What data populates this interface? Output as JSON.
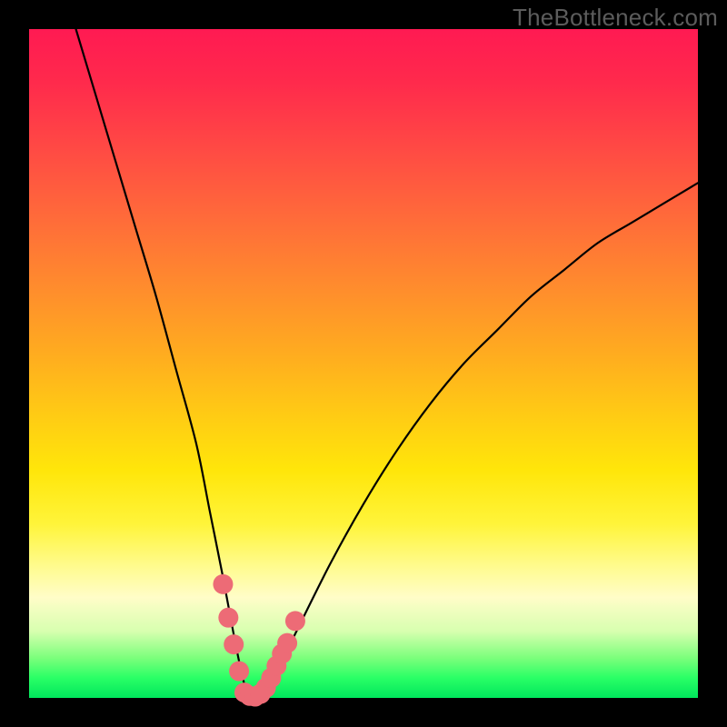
{
  "watermark": "TheBottleneck.com",
  "chart_data": {
    "type": "line",
    "title": "",
    "xlabel": "",
    "ylabel": "",
    "xlim": [
      0,
      100
    ],
    "ylim": [
      0,
      100
    ],
    "background_gradient": [
      "#ff1a52",
      "#ff8a2e",
      "#ffe60a",
      "#fffdc8",
      "#00e65c"
    ],
    "series": [
      {
        "name": "bottleneck-curve",
        "x": [
          7,
          10,
          13,
          16,
          19,
          22,
          25,
          27,
          29,
          30.5,
          31.5,
          32.5,
          33.5,
          34.5,
          36,
          38,
          40,
          45,
          50,
          55,
          60,
          65,
          70,
          75,
          80,
          85,
          90,
          95,
          100
        ],
        "y": [
          100,
          90,
          80,
          70,
          60,
          49,
          38,
          28,
          18,
          10,
          5,
          1,
          0,
          1,
          3,
          6,
          10,
          20,
          29,
          37,
          44,
          50,
          55,
          60,
          64,
          68,
          71,
          74,
          77
        ]
      }
    ],
    "markers": [
      {
        "name": "marker-group-left",
        "x": [
          29.0,
          29.8,
          30.6,
          31.4
        ],
        "y": [
          17,
          12,
          8,
          4
        ]
      },
      {
        "name": "marker-group-bottom",
        "x": [
          32.2,
          33.0,
          33.8,
          34.6,
          35.4
        ],
        "y": [
          0.8,
          0.3,
          0.2,
          0.6,
          1.5
        ]
      },
      {
        "name": "marker-group-right",
        "x": [
          36.2,
          37.0,
          37.8,
          38.6,
          39.8
        ],
        "y": [
          3.0,
          4.8,
          6.6,
          8.2,
          11.5
        ]
      }
    ],
    "marker_style": {
      "color": "#ed6b76",
      "radius_px": 11
    }
  }
}
